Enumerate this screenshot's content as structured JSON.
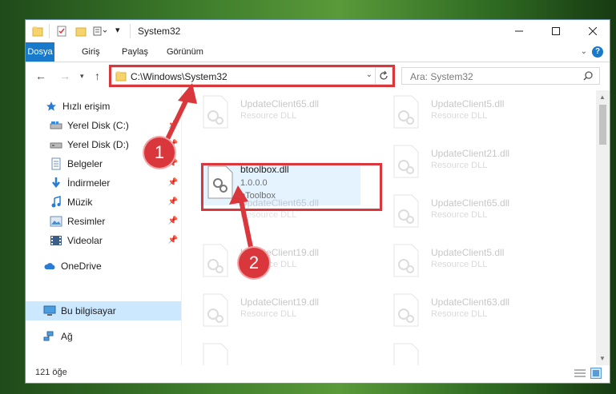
{
  "window": {
    "title": "System32"
  },
  "ribbon": {
    "tabs": [
      "Dosya",
      "Giriş",
      "Paylaş",
      "Görünüm"
    ],
    "active": "Dosya",
    "help_symbol": "?"
  },
  "address": {
    "path": "C:\\Windows\\System32"
  },
  "search": {
    "placeholder": "Ara: System32"
  },
  "sidebar": {
    "items": [
      {
        "label": "Hızlı erişim",
        "icon": "star-icon",
        "pinned": false
      },
      {
        "label": "Yerel Disk (C:)",
        "icon": "drive-icon",
        "pinned": true
      },
      {
        "label": "Yerel Disk (D:)",
        "icon": "drive-icon",
        "pinned": true
      },
      {
        "label": "Belgeler",
        "icon": "document-icon",
        "pinned": true
      },
      {
        "label": "İndirmeler",
        "icon": "download-icon",
        "pinned": true
      },
      {
        "label": "Müzik",
        "icon": "music-icon",
        "pinned": true
      },
      {
        "label": "Resimler",
        "icon": "pictures-icon",
        "pinned": true
      },
      {
        "label": "Videolar",
        "icon": "video-icon",
        "pinned": true
      },
      {
        "label": "OneDrive",
        "icon": "cloud-icon",
        "pinned": false
      },
      {
        "label": "Bu bilgisayar",
        "icon": "computer-icon",
        "pinned": false,
        "selected": true
      },
      {
        "label": "Ağ",
        "icon": "network-icon",
        "pinned": false
      }
    ]
  },
  "files": {
    "focus": {
      "name": "btoolbox.dll",
      "version": "1.0.0.0",
      "desc": "bToolbox"
    },
    "faded": [
      {
        "name": "UpdateClient65.dll",
        "desc": "Resource DLL"
      },
      {
        "name": "UpdateClient5.dll",
        "desc": "Resource DLL"
      },
      {
        "name": "UpdateClient21.dll",
        "desc": "Resource DLL"
      },
      {
        "name": "UpdateClient65.dll",
        "desc": "Resource DLL"
      },
      {
        "name": "UpdateClient65.dll",
        "desc": "Resource DLL"
      },
      {
        "name": "UpdateClient19.dll",
        "desc": "Resource DLL"
      },
      {
        "name": "UpdateClient5.dll",
        "desc": "Resource DLL"
      },
      {
        "name": "UpdateClient19.dll",
        "desc": "Resource DLL"
      },
      {
        "name": "UpdateClient63.dll",
        "desc": "Resource DLL"
      }
    ]
  },
  "status": {
    "count": "121 öğe"
  },
  "callouts": {
    "one": "1",
    "two": "2"
  },
  "colors": {
    "accent": "#1979ca",
    "highlight_red": "#d9373b",
    "selection": "#cce8ff"
  }
}
